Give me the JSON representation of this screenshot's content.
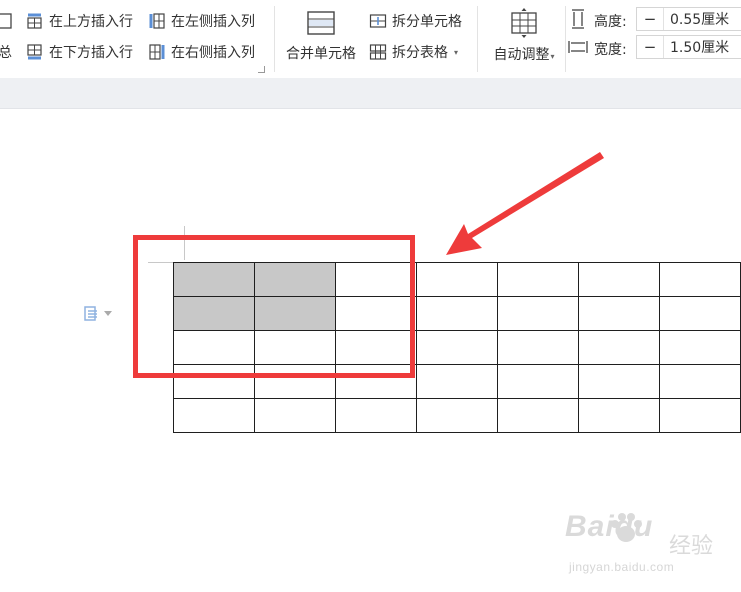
{
  "ribbon": {
    "summary_label": "总",
    "insert_row_above": "在上方插入行",
    "insert_row_below": "在下方插入行",
    "insert_col_left": "在左侧插入列",
    "insert_col_right": "在右侧插入列",
    "merge_cells": "合并单元格",
    "split_cells": "拆分单元格",
    "split_table": "拆分表格",
    "auto_fit": "自动调整",
    "height_label": "高度:",
    "height_value": "0.55厘米",
    "width_label": "宽度:",
    "width_value": "1.50厘米",
    "minus_symbol": "−",
    "dropdown_caret": "▾"
  },
  "table": {
    "rows": 5,
    "cols": 7,
    "selected_cells": [
      [
        0,
        0
      ],
      [
        0,
        1
      ],
      [
        1,
        0
      ],
      [
        1,
        1
      ]
    ]
  },
  "watermark": {
    "logo": "Baidu",
    "brand_text": "经验",
    "url": "jingyan.baidu.com"
  },
  "colors": {
    "accent_red": "#ee3b3b",
    "selection_gray": "#c8c8c8",
    "icon_blue": "#8fb2e0"
  }
}
